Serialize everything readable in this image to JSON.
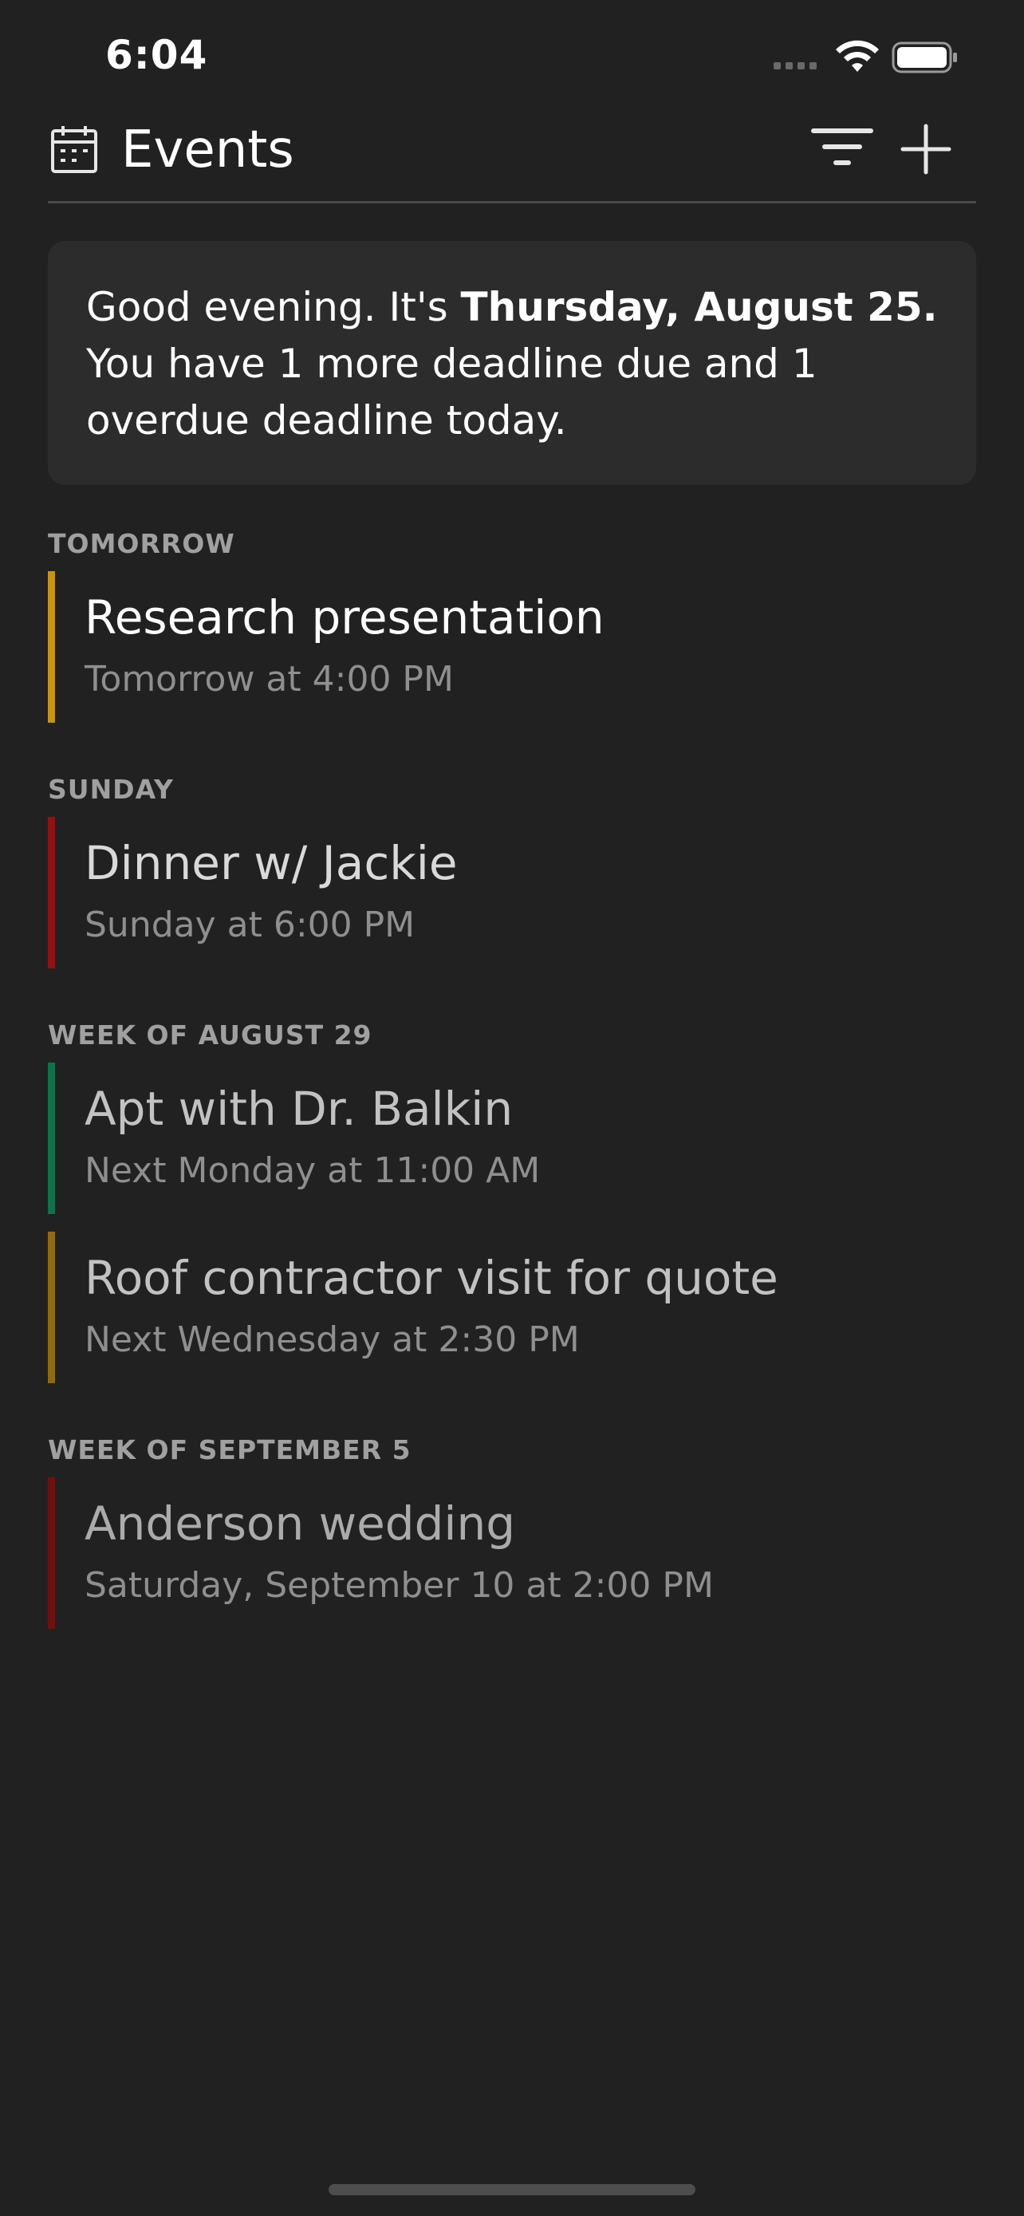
{
  "status_bar": {
    "time": "6:04"
  },
  "header": {
    "title": "Events",
    "icons": {
      "leading": "calendar-icon",
      "filter": "filter-icon",
      "add": "plus-icon"
    }
  },
  "greeting": {
    "prefix": "Good evening. It's ",
    "date": "Thursday, August 25.",
    "message": "You have 1 more deadline due and 1 overdue deadline today."
  },
  "sections": [
    {
      "label": "TOMORROW",
      "events": [
        {
          "title": "Research presentation",
          "time": "Tomorrow at 4:00 PM",
          "color": "#c7941a"
        }
      ]
    },
    {
      "label": "SUNDAY",
      "events": [
        {
          "title": "Dinner w/ Jackie",
          "time": "Sunday at 6:00 PM",
          "color": "#8e1414"
        }
      ]
    },
    {
      "label": "WEEK OF AUGUST 29",
      "events": [
        {
          "title": "Apt with Dr. Balkin",
          "time": "Next Monday at 11:00 AM",
          "color": "#10714a"
        },
        {
          "title": "Roof contractor visit for quote",
          "time": "Next Wednesday at 2:30 PM",
          "color": "#8f6a12"
        }
      ]
    },
    {
      "label": "WEEK OF SEPTEMBER 5",
      "events": [
        {
          "title": "Anderson wedding",
          "time": "Saturday, September 10 at 2:00 PM",
          "color": "#6e1111"
        }
      ]
    }
  ]
}
